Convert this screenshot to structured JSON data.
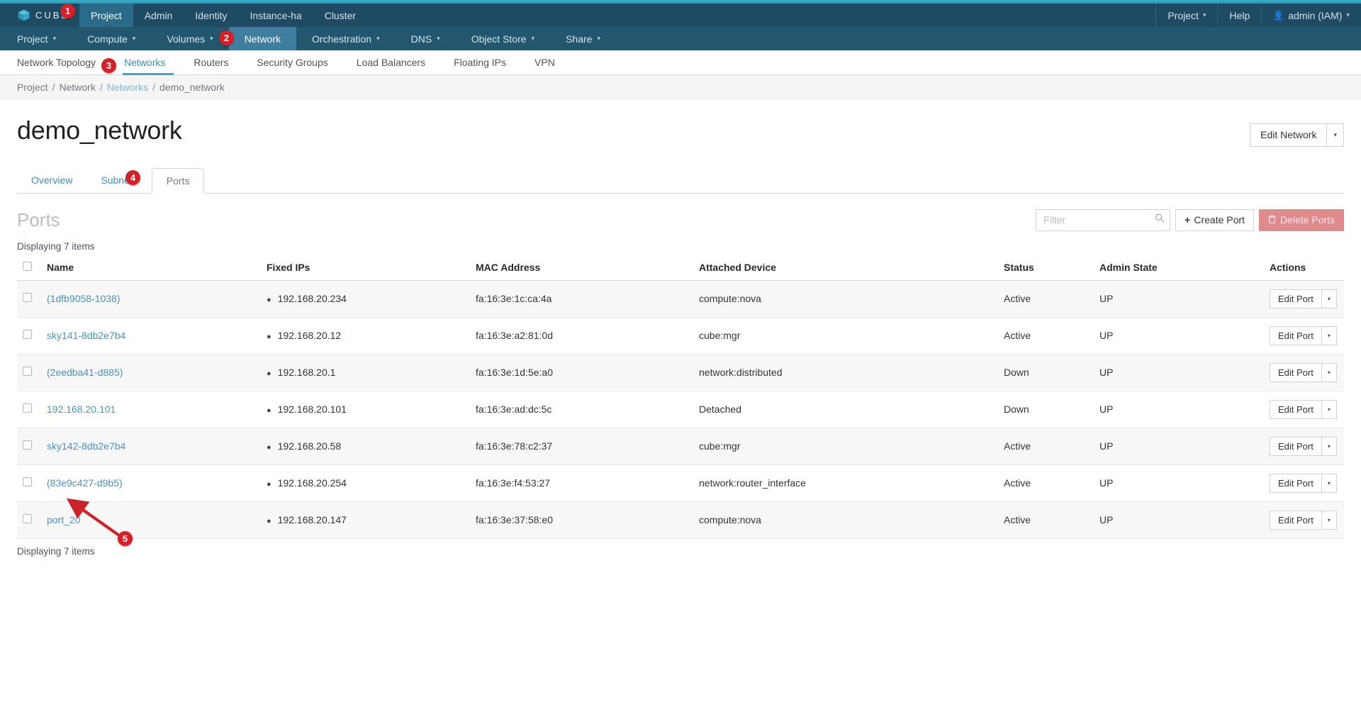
{
  "brand": {
    "name": "CUBE",
    "logo_icon": "cube-logo-icon"
  },
  "topnav": {
    "items": [
      {
        "label": "Project",
        "active": true
      },
      {
        "label": "Admin",
        "active": false
      },
      {
        "label": "Identity",
        "active": false
      },
      {
        "label": "Instance-ha",
        "active": false
      },
      {
        "label": "Cluster",
        "active": false
      }
    ],
    "right": [
      {
        "label": "Project",
        "caret": "⌄",
        "icon": ""
      },
      {
        "label": "Help",
        "caret": "",
        "icon": ""
      },
      {
        "label": "admin (IAM)",
        "caret": "⌄",
        "icon": "user-icon"
      }
    ]
  },
  "mainnav": {
    "items": [
      {
        "label": "Project",
        "caret": "⌄",
        "active": false
      },
      {
        "label": "Compute",
        "caret": "⌄",
        "active": false
      },
      {
        "label": "Volumes",
        "caret": "⌄",
        "active": false
      },
      {
        "label": "Network",
        "caret": "",
        "active": true
      },
      {
        "label": "Orchestration",
        "caret": "⌄",
        "active": false
      },
      {
        "label": "DNS",
        "caret": "⌄",
        "active": false
      },
      {
        "label": "Object Store",
        "caret": "⌄",
        "active": false
      },
      {
        "label": "Share",
        "caret": "⌄",
        "active": false
      }
    ]
  },
  "subnav": {
    "items": [
      {
        "label": "Network Topology",
        "active": false
      },
      {
        "label": "Networks",
        "active": true
      },
      {
        "label": "Routers",
        "active": false
      },
      {
        "label": "Security Groups",
        "active": false
      },
      {
        "label": "Load Balancers",
        "active": false
      },
      {
        "label": "Floating IPs",
        "active": false
      },
      {
        "label": "VPN",
        "active": false
      }
    ]
  },
  "breadcrumb": {
    "items": [
      {
        "label": "Project",
        "link": false
      },
      {
        "label": "Network",
        "link": false
      },
      {
        "label": "Networks",
        "link": true
      },
      {
        "label": "demo_network",
        "link": false
      }
    ],
    "separator": "/"
  },
  "page": {
    "title": "demo_network",
    "edit_network_label": "Edit Network",
    "edit_network_caret": "▾"
  },
  "detail_tabs": [
    {
      "label": "Overview",
      "active": false
    },
    {
      "label": "Subnets",
      "active": false
    },
    {
      "label": "Ports",
      "active": true
    }
  ],
  "ports_section": {
    "title": "Ports",
    "filter_placeholder": "Filter",
    "filter_value": "",
    "search_icon": "search-icon",
    "create_label": "Create Port",
    "create_icon": "plus-icon",
    "delete_label": "Delete Ports",
    "delete_icon": "trash-icon",
    "count_top": "Displaying 7 items",
    "count_bottom": "Displaying 7 items",
    "columns": [
      "Name",
      "Fixed IPs",
      "MAC Address",
      "Attached Device",
      "Status",
      "Admin State",
      "Actions"
    ],
    "row_action_label": "Edit Port",
    "row_action_caret": "▾",
    "rows": [
      {
        "name": "(1dfb9058-1038)",
        "fixed_ip": "192.168.20.234",
        "mac": "fa:16:3e:1c:ca:4a",
        "device": "compute:nova",
        "status": "Active",
        "admin_state": "UP"
      },
      {
        "name": "sky141-8db2e7b4",
        "fixed_ip": "192.168.20.12",
        "mac": "fa:16:3e:a2:81:0d",
        "device": "cube:mgr",
        "status": "Active",
        "admin_state": "UP"
      },
      {
        "name": "(2eedba41-d885)",
        "fixed_ip": "192.168.20.1",
        "mac": "fa:16:3e:1d:5e:a0",
        "device": "network:distributed",
        "status": "Down",
        "admin_state": "UP"
      },
      {
        "name": "192.168.20.101",
        "fixed_ip": "192.168.20.101",
        "mac": "fa:16:3e:ad:dc:5c",
        "device": "Detached",
        "status": "Down",
        "admin_state": "UP"
      },
      {
        "name": "sky142-8db2e7b4",
        "fixed_ip": "192.168.20.58",
        "mac": "fa:16:3e:78:c2:37",
        "device": "cube:mgr",
        "status": "Active",
        "admin_state": "UP"
      },
      {
        "name": "(83e9c427-d9b5)",
        "fixed_ip": "192.168.20.254",
        "mac": "fa:16:3e:f4:53:27",
        "device": "network:router_interface",
        "status": "Active",
        "admin_state": "UP"
      },
      {
        "name": "port_20",
        "fixed_ip": "192.168.20.147",
        "mac": "fa:16:3e:37:58:e0",
        "device": "compute:nova",
        "status": "Active",
        "admin_state": "UP"
      }
    ]
  },
  "annotations": {
    "badges": [
      {
        "number": "1",
        "target": "brand-project-tab"
      },
      {
        "number": "2",
        "target": "mainnav-network"
      },
      {
        "number": "3",
        "target": "subnav-networks"
      },
      {
        "number": "4",
        "target": "detail-tab-ports"
      },
      {
        "number": "5",
        "target": "row-port_20-name"
      }
    ],
    "arrow_color": "#cc2229"
  },
  "colors": {
    "accent": "#39a5d4",
    "topnav_bg": "#1e4a63",
    "mainnav_bg": "#23566f",
    "link": "#4b93b8",
    "danger": "#e08b8b",
    "badge": "#d62027"
  }
}
